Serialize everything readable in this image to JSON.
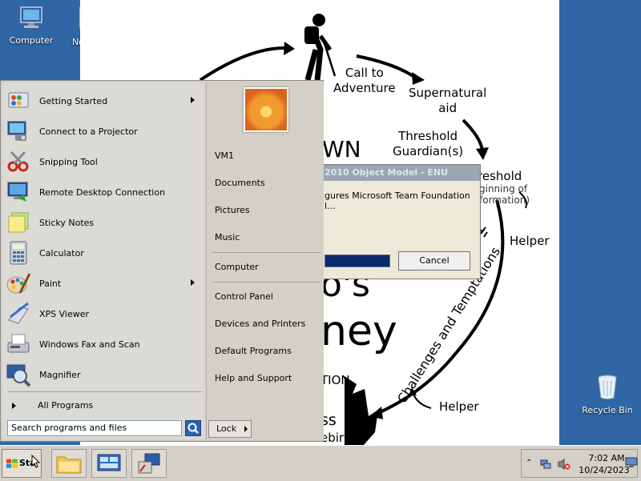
{
  "desktop": {
    "icons": [
      {
        "label": "Computer",
        "icon": "computer-icon"
      },
      {
        "label": "No",
        "icon": "notepad-plus-icon"
      },
      {
        "label": "Recycle Bin",
        "icon": "recycle-bin-icon"
      }
    ]
  },
  "wallpaper": {
    "call_to_adventure": "Call to\nAdventure",
    "supernatural_aid": "Supernatural\naid",
    "threshold_guardians": "Threshold\nGuardian(s)",
    "threshold": "reshold",
    "threshold_sub1": "ginning of",
    "threshold_sub2": "formation)",
    "helper_top": "Helper",
    "helper_bottom": "Helper",
    "challenges": "Challenges and Temptations",
    "wn": "WN",
    "os": "o's",
    "ney": "ney",
    "tion": "TION",
    "ss": "ss",
    "ebirth": "ebirth"
  },
  "install_dialog": {
    "title": "2010 Object Model - ENU",
    "message": "gures Microsoft Team Foundation\nl...",
    "cancel_label": "Cancel",
    "progress": 0.6
  },
  "start_menu": {
    "programs": [
      {
        "label": "Getting Started",
        "icon": "getting-started-icon",
        "submenu": true
      },
      {
        "label": "Connect to a Projector",
        "icon": "projector-icon",
        "submenu": false
      },
      {
        "label": "Snipping Tool",
        "icon": "snipping-tool-icon",
        "submenu": false
      },
      {
        "label": "Remote Desktop Connection",
        "icon": "remote-desktop-icon",
        "submenu": false
      },
      {
        "label": "Sticky Notes",
        "icon": "sticky-notes-icon",
        "submenu": false
      },
      {
        "label": "Calculator",
        "icon": "calculator-icon",
        "submenu": false
      },
      {
        "label": "Paint",
        "icon": "paint-icon",
        "submenu": true
      },
      {
        "label": "XPS Viewer",
        "icon": "xps-viewer-icon",
        "submenu": false
      },
      {
        "label": "Windows Fax and Scan",
        "icon": "fax-scan-icon",
        "submenu": false
      },
      {
        "label": "Magnifier",
        "icon": "magnifier-icon",
        "submenu": false
      }
    ],
    "all_programs": "All Programs",
    "search_placeholder": "Search programs and files",
    "right_items": {
      "user": "VM1",
      "documents": "Documents",
      "pictures": "Pictures",
      "music": "Music",
      "computer": "Computer",
      "control_panel": "Control Panel",
      "devices": "Devices and Printers",
      "default_programs": "Default Programs",
      "help": "Help and Support"
    },
    "lock_label": "Lock"
  },
  "taskbar": {
    "start_label": "Sta",
    "clock_time": "7:02 AM",
    "clock_date": "10/24/2023"
  }
}
